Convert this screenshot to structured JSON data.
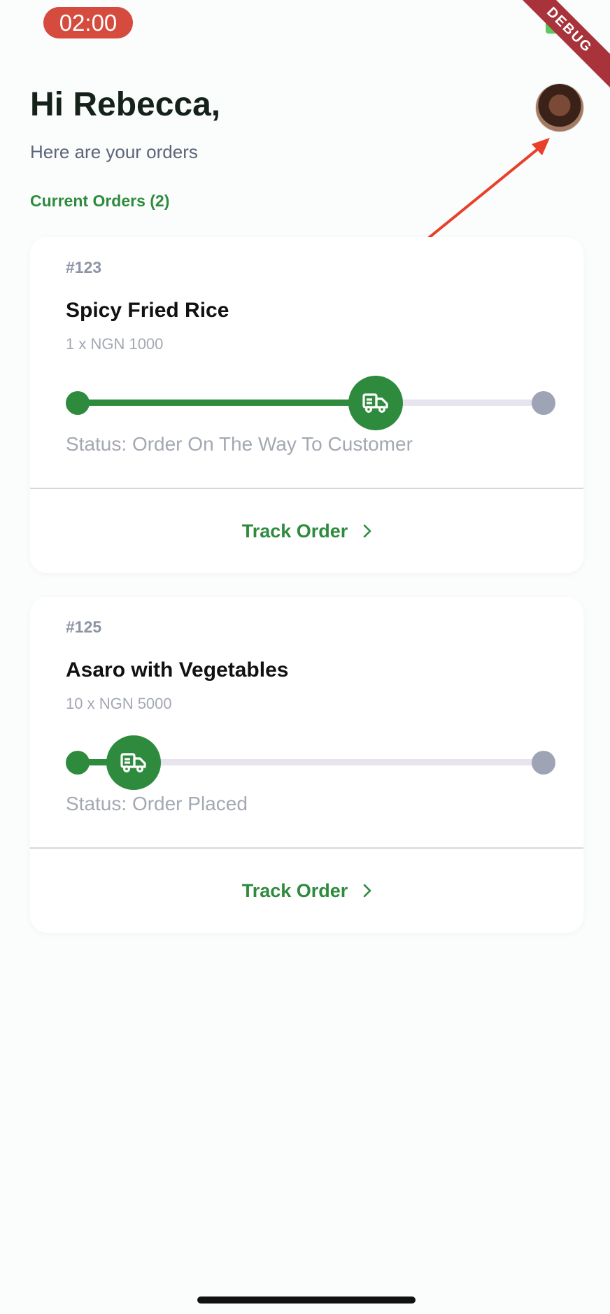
{
  "status_bar": {
    "time": "02:00",
    "debug_label": "DEBUG"
  },
  "header": {
    "greeting": "Hi Rebecca,",
    "subtitle": "Here are your orders",
    "section_label": "Current Orders (2)",
    "avatar_icon": "user-avatar"
  },
  "orders": [
    {
      "id": "#123",
      "name": "Spicy Fried Rice",
      "quantity_price": "1 x NGN 1000",
      "progress": 0.64,
      "status": "Status: Order On The Way To Customer",
      "action_label": "Track Order"
    },
    {
      "id": "#125",
      "name": "Asaro with Vegetables",
      "quantity_price": "10 x NGN 5000",
      "progress": 0.12,
      "status": "Status: Order Placed",
      "action_label": "Track Order"
    }
  ],
  "colors": {
    "accent": "#2e8b3e",
    "rail": "#e7e4ee",
    "endpoint": "#9ea4b5",
    "annotation_arrow": "#e8402a"
  }
}
